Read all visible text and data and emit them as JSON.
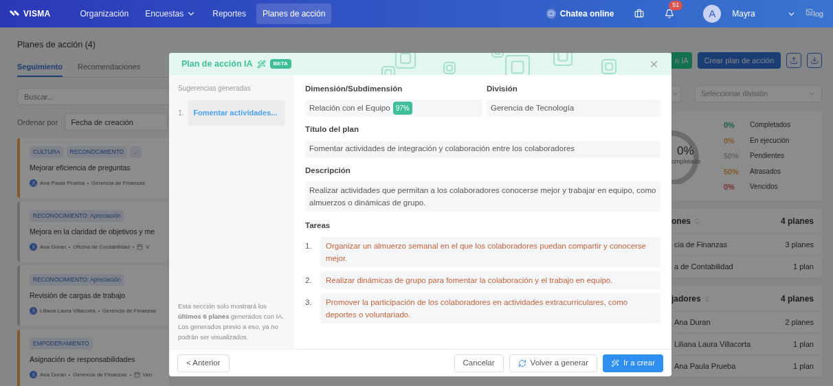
{
  "header": {
    "logo": "VISMA",
    "nav": [
      {
        "label": "Organización",
        "selected": false,
        "dropdown": false
      },
      {
        "label": "Encuestas",
        "selected": false,
        "dropdown": true
      },
      {
        "label": "Reportes",
        "selected": false,
        "dropdown": false
      },
      {
        "label": "Planes de acción",
        "selected": true,
        "dropdown": false
      }
    ],
    "chat": "Chatea online",
    "notifications": "51",
    "avatar": "A",
    "user": "Mayra",
    "broken_image": "log"
  },
  "page": {
    "title": "Planes de acción (4)",
    "tabs": [
      {
        "label": "Seguimiento",
        "selected": true
      },
      {
        "label": "Recomendaciones",
        "selected": false
      }
    ],
    "search": {
      "placeholder": "Buscar..."
    },
    "sort_label": "Ordenar por",
    "sort_value": "Fecha de creación",
    "ai_button": "n IA",
    "create_button": "Crear plan de acción",
    "division_select": {
      "placeholder": "Seleccionar división"
    }
  },
  "cards": [
    {
      "tags": [
        "CULTURA",
        "RECONOCIMIENTO",
        "..."
      ],
      "title": "Mejorar eficiencia de preguntas",
      "owner": "Ana Paula Prueba",
      "division": "Gerencia de Finanzas",
      "color": "#805929"
    },
    {
      "tags": [
        "RECONOCIMIENTO: Apreciación"
      ],
      "title": "Mejora en la claridad de objetivos y me",
      "owner": "Ana Duran",
      "division": "Oficina de Contabilidad",
      "date": "V",
      "color": "#6c6c6c"
    },
    {
      "tags": [
        "RECONOCIMIENTO: Apreciación"
      ],
      "title": "Revisión de cargas de trabajo",
      "owner": "Liliana Laura Villacorta",
      "division": "Gerencia de Finanzas",
      "color": "#6c6c6c"
    },
    {
      "tags": [
        "EMPODERAMIENTO"
      ],
      "title": "Asignación de responsabilidades",
      "owner": "Ana Duran",
      "division": "Gerencia de Finanzas",
      "date": "Ven",
      "color": "#805929"
    }
  ],
  "stats": {
    "center": "0%",
    "center_label": "ompletado",
    "legend": [
      {
        "pct": "0%",
        "label": "Completados",
        "color": "#1a604c"
      },
      {
        "pct": "0%",
        "label": "En ejecución",
        "color": "#805929"
      },
      {
        "pct": "50%",
        "label": "Pendientes",
        "color": "#646464"
      },
      {
        "pct": "50%",
        "label": "Atrasados",
        "color": "#805929"
      },
      {
        "pct": "0%",
        "label": "Vencidos",
        "color": "#773030"
      }
    ]
  },
  "divisions": {
    "title": "ones",
    "total": "4 planes",
    "rows": [
      {
        "name": "cia de Finanzas",
        "count": "3 planes"
      },
      {
        "name": "a de Contabilidad",
        "count": "1 plan"
      }
    ]
  },
  "workers": {
    "title": "jadores",
    "total": "4 planes",
    "rows": [
      {
        "name": "Ana Duran",
        "count": "2 planes"
      },
      {
        "name": "Liliana Laura Villacorta",
        "count": "1 plan"
      },
      {
        "name": "Ana Paula Prueba",
        "count": "1 plan"
      }
    ]
  },
  "modal": {
    "title": "Plan de acción IA",
    "badge": "BETA",
    "sidebar_title": "Sugerencias generadas",
    "suggestions": [
      {
        "number": "1.",
        "text": "Fomentar actividades...",
        "selected": true
      }
    ],
    "note": "Esta sección solo mostrará los **últimos 6 planes** generados con IA. Los generados previo a eso, ya no podrán ser visualizados.",
    "dimension": {
      "label": "Dimensión/Subdimensión",
      "value": "Relación con el Equipo",
      "score": "97%"
    },
    "division": {
      "label": "División",
      "value": "Gerencia de Tecnología"
    },
    "plan_title": {
      "label": "Título del plan",
      "value": "Fomentar actividades de integración y colaboración entre los colaboradores"
    },
    "description": {
      "label": "Descripción",
      "value": "Realizar actividades que permitan a los colaboradores conocerse mejor y trabajar en equipo, como almuerzos o dinámicas de grupo."
    },
    "tasks_label": "Tareas",
    "tasks": [
      {
        "number": "1.",
        "text": "Organizar un almuerzo semanal en el que los colaboradores puedan compartir y conocerse mejor."
      },
      {
        "number": "2.",
        "text": "Realizar dinámicas de grupo para fomentar la colaboración y el trabajo en equipo."
      },
      {
        "number": "3.",
        "text": "Promover la participación de los colaboradores en actividades extracurriculares, como deportes o voluntariado."
      }
    ],
    "buttons": {
      "previous": "< Anterior",
      "cancel": "Cancelar",
      "regenerate": "Volver a generar",
      "create": "Ir a crear"
    }
  }
}
